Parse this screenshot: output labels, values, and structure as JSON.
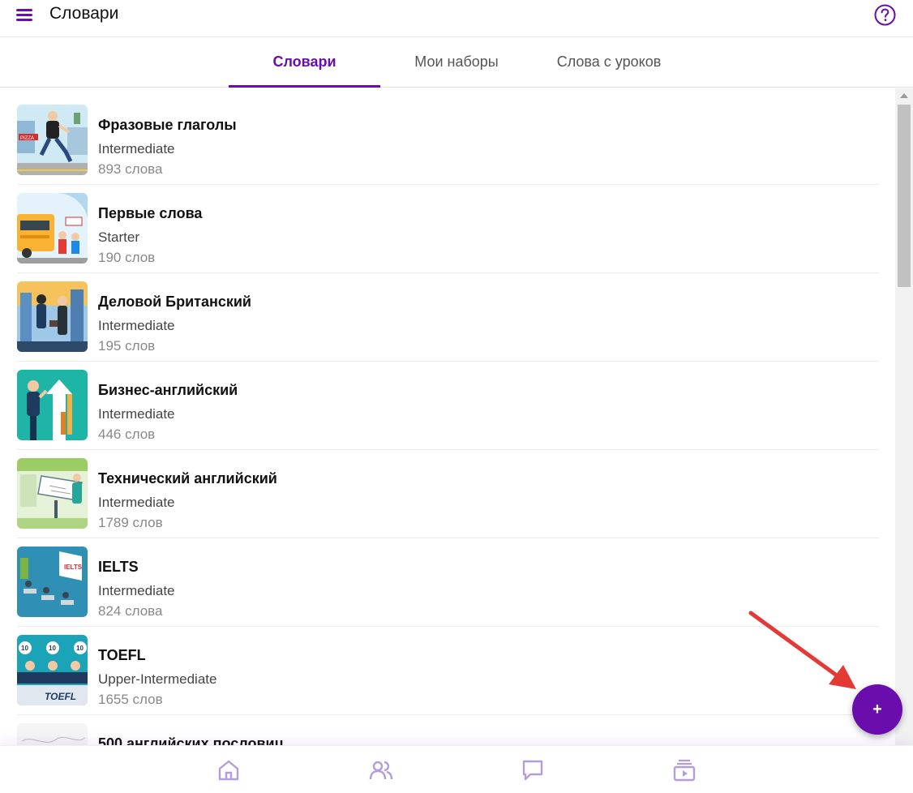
{
  "header": {
    "title": "Словари",
    "menu_icon": "hamburger-menu-icon",
    "help_icon": "help-circle-icon"
  },
  "tabs": [
    {
      "label": "Словари",
      "active": true
    },
    {
      "label": "Мои наборы",
      "active": false
    },
    {
      "label": "Слова с уроков",
      "active": false
    }
  ],
  "items": [
    {
      "title": "Фразовые глаголы",
      "level": "Intermediate",
      "count": "893 слова"
    },
    {
      "title": "Первые слова",
      "level": "Starter",
      "count": "190 слов"
    },
    {
      "title": "Деловой Британский",
      "level": "Intermediate",
      "count": "195 слов"
    },
    {
      "title": "Бизнес-английский",
      "level": "Intermediate",
      "count": "446 слов"
    },
    {
      "title": "Технический английский",
      "level": "Intermediate",
      "count": "1789 слов"
    },
    {
      "title": "IELTS",
      "level": "Intermediate",
      "count": "824 слова"
    },
    {
      "title": "TOEFL",
      "level": "Upper-Intermediate",
      "count": "1655 слов"
    },
    {
      "title": "500 английских пословиц",
      "level": "",
      "count": ""
    }
  ],
  "thumb_text": {
    "pizza": "PIZZA",
    "ielts": "IELTS",
    "toefl": "TOEFL",
    "ten": "10"
  },
  "fab": {
    "label": "+"
  },
  "bottom_nav": [
    {
      "icon": "home-icon"
    },
    {
      "icon": "users-icon"
    },
    {
      "icon": "chat-icon"
    },
    {
      "icon": "video-library-icon"
    }
  ],
  "colors": {
    "accent": "#6a0dad",
    "nav_icon": "#b39ddb",
    "annotation_arrow": "#e53935"
  }
}
